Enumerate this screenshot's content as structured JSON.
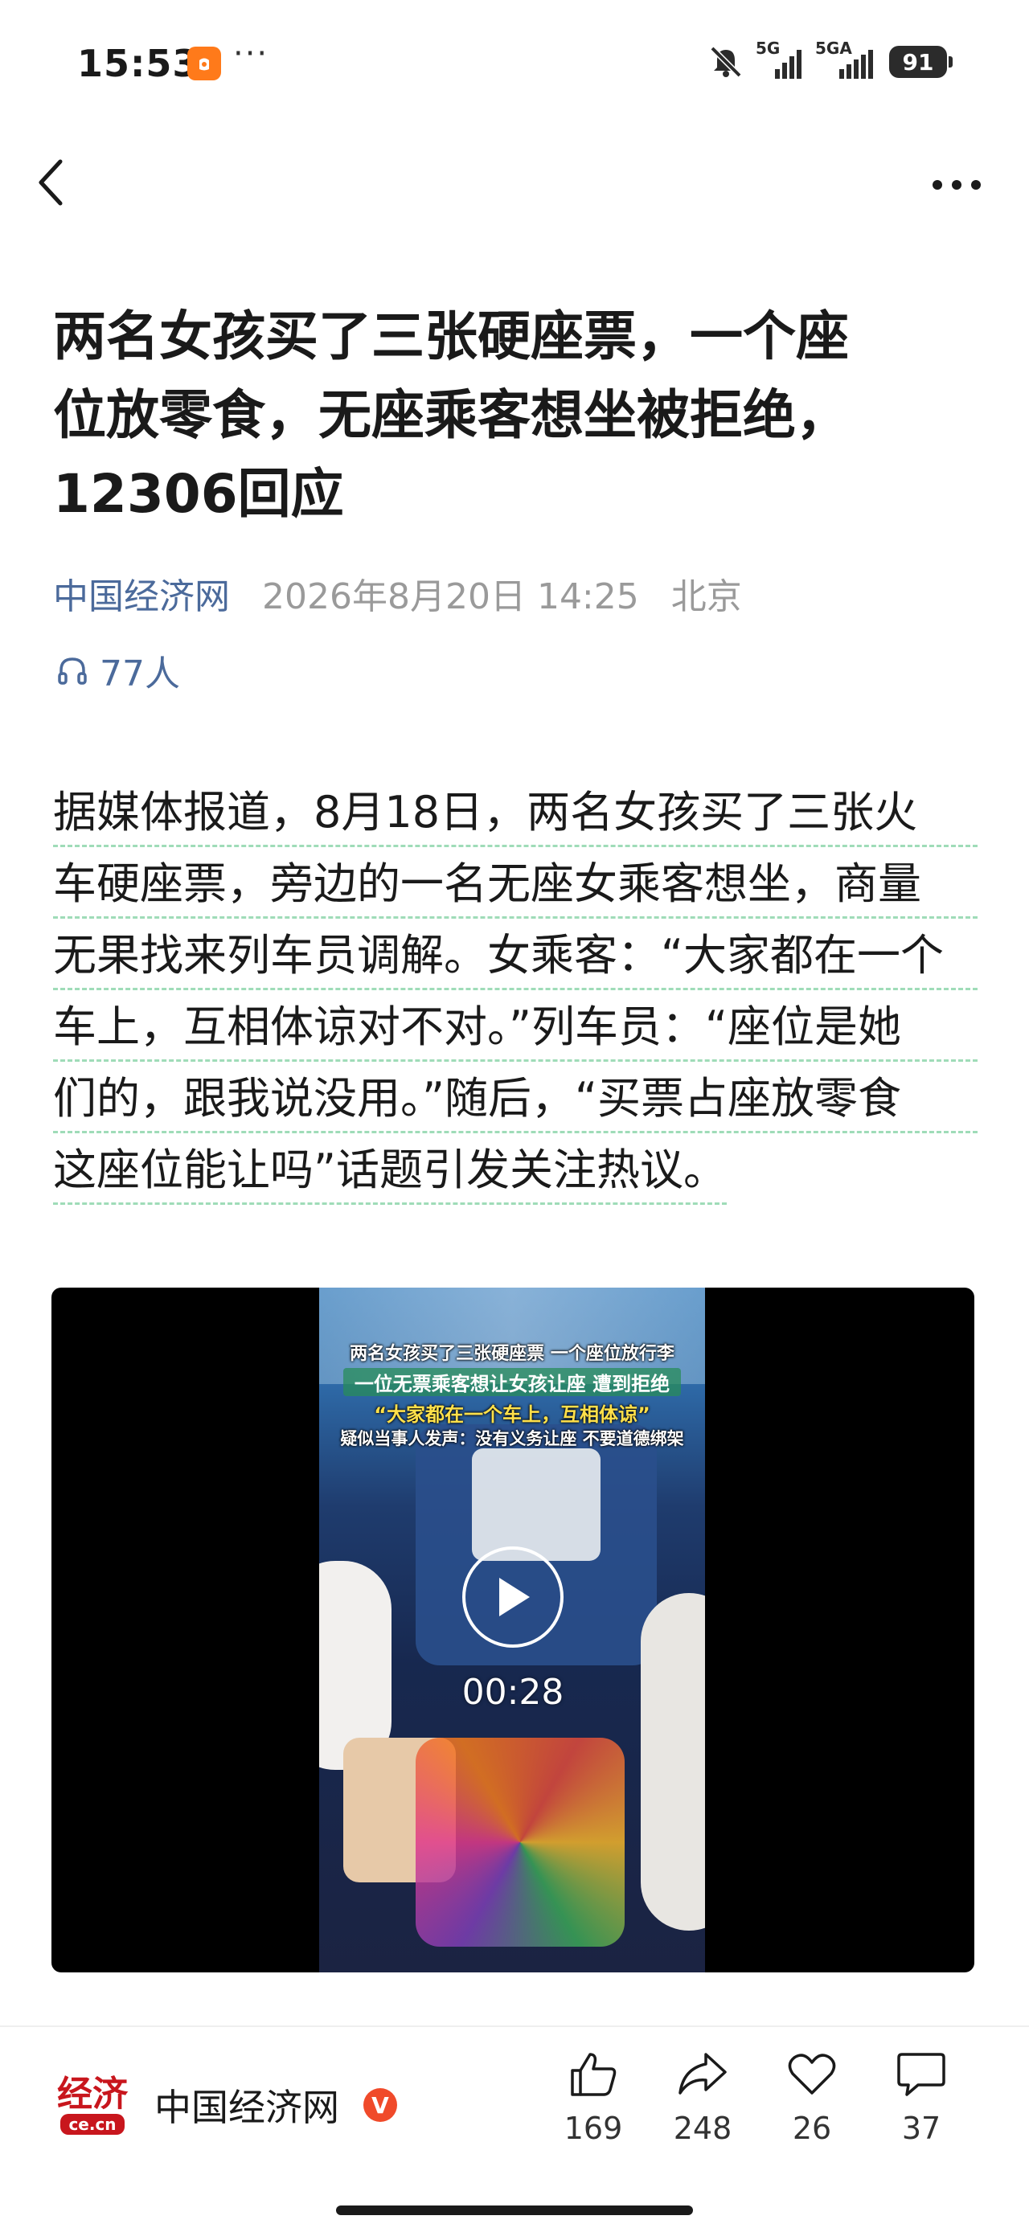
{
  "status_bar": {
    "time": "15:53",
    "more": "···",
    "network1": "5G",
    "network2": "5GA",
    "battery": "91"
  },
  "article": {
    "title_lines": [
      "两名女孩买了三张硬座票，一个座",
      "位放零食，无座乘客想坐被拒绝，",
      "12306回应"
    ],
    "source": "中国经济网",
    "date": "2026年8月20日 14:25",
    "location": "北京",
    "listeners": "77人",
    "paragraph_lines": [
      "据媒体报道，8月18日，两名女孩买了三张火",
      "车硬座票，旁边的一名无座女乘客想坐，商量",
      "无果找来列车员调解。女乘客：“大家都在一个",
      "车上，互相体谅对不对。”列车员：“座位是她",
      "们的，跟我说没用。”随后，“买票占座放零食",
      "这座位能让吗”话题引发关注热议。"
    ]
  },
  "video": {
    "caption1": "两名女孩买了三张硬座票 一个座位放行李",
    "caption2": "一位无票乘客想让女孩让座 遭到拒绝",
    "caption3": "“大家都在一个车上，互相体谅”",
    "caption4": "疑似当事人发声：没有义务让座 不要道德绑架",
    "duration": "00:28"
  },
  "footer": {
    "publisher_name": "中国经济网",
    "logo_text": "经济",
    "logo_sub": "ce.cn",
    "verified_mark": "V",
    "like_count": "169",
    "share_count": "248",
    "favorite_count": "26",
    "comment_count": "37"
  },
  "colors": {
    "source_link": "#4b6a9b",
    "underline_dash": "#9fdcb8",
    "verified": "#f04a2a",
    "logo_red": "#c8161d"
  }
}
